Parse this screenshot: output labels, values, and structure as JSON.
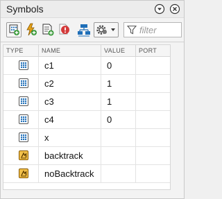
{
  "panel": {
    "title": "Symbols"
  },
  "toolbar": {
    "buttons": [
      {
        "name": "add-data-button",
        "icon": "add-data-icon"
      },
      {
        "name": "add-event-button",
        "icon": "add-event-icon"
      },
      {
        "name": "add-message-button",
        "icon": "add-message-icon"
      },
      {
        "name": "resolve-undefined-button",
        "icon": "resolve-undefined-icon"
      },
      {
        "name": "model-explorer-button",
        "icon": "hierarchy-icon"
      },
      {
        "name": "settings-dropdown-button",
        "icon": "gear-icon"
      }
    ],
    "filter": {
      "placeholder": "filter",
      "value": ""
    }
  },
  "table": {
    "columns": [
      "TYPE",
      "NAME",
      "VALUE",
      "PORT"
    ],
    "rows": [
      {
        "type": "data",
        "name": "c1",
        "value": "0",
        "port": ""
      },
      {
        "type": "data",
        "name": "c2",
        "value": "1",
        "port": ""
      },
      {
        "type": "data",
        "name": "c3",
        "value": "1",
        "port": ""
      },
      {
        "type": "data",
        "name": "c4",
        "value": "0",
        "port": ""
      },
      {
        "type": "data",
        "name": "x",
        "value": "",
        "port": ""
      },
      {
        "type": "event",
        "name": "backtrack",
        "value": "",
        "port": ""
      },
      {
        "type": "event",
        "name": "noBacktrack",
        "value": "",
        "port": ""
      }
    ]
  },
  "colors": {
    "accent_blue": "#1f6fb8",
    "event_orange": "#e5a21a",
    "add_green": "#3a9a3a",
    "stop_red": "#d43a3a"
  }
}
